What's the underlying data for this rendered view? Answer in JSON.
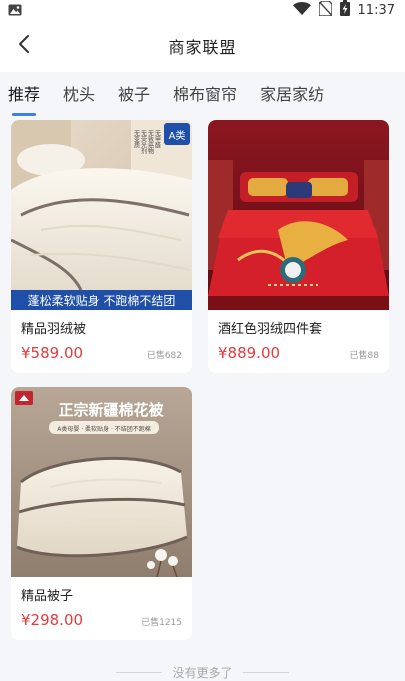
{
  "status_bar": {
    "time": "11:37"
  },
  "nav": {
    "title": "商家联盟"
  },
  "tabs": [
    {
      "label": "推荐",
      "active": true
    },
    {
      "label": "枕头",
      "active": false
    },
    {
      "label": "被子",
      "active": false
    },
    {
      "label": "棉布窗帘",
      "active": false
    },
    {
      "label": "家居家纺",
      "active": false
    }
  ],
  "products": [
    {
      "title": "精品羽绒被",
      "price": "¥589.00",
      "sold": "已售682",
      "image_caption": "蓬松柔软贴身 不跑棉不结团",
      "image_tag": "A类",
      "image_side_text": [
        "无甲醛",
        "无致癌物",
        "无荧光剂",
        "无变质"
      ]
    },
    {
      "title": "酒红色羽绒四件套",
      "price": "¥889.00",
      "sold": "已售88"
    },
    {
      "title": "精品被子",
      "price": "¥298.00",
      "sold": "已售1215",
      "image_heading": "正宗新疆棉花被",
      "image_subheading": "A类母婴 · 柔软贴身 · 不结团不跑棉"
    }
  ],
  "footer": {
    "text": "没有更多了"
  },
  "colors": {
    "accent": "#3f7cf0",
    "price": "#e33b3b",
    "background": "#f4f6f9"
  }
}
